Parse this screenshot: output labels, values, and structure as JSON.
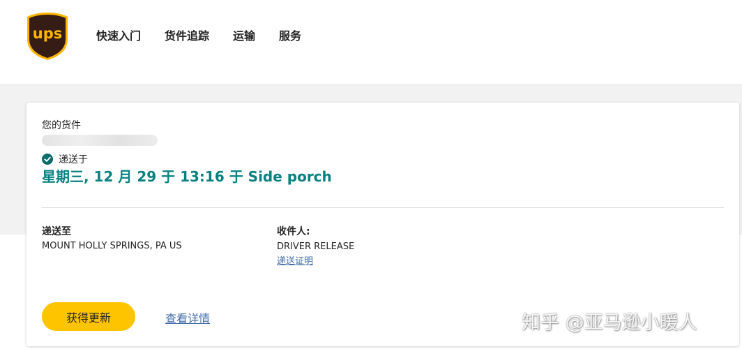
{
  "header": {
    "logo_text": "ups",
    "nav": [
      {
        "label": "快速入门"
      },
      {
        "label": "货件追踪"
      },
      {
        "label": "运输"
      },
      {
        "label": "服务"
      }
    ]
  },
  "shipment": {
    "title": "您的货件",
    "status_label": "递送于",
    "delivery_date": "星期三, 12 月 29 于 13:16 于 Side porch",
    "delivered_to_label": "递送至",
    "delivered_to_value": "MOUNT HOLLY SPRINGS, PA US",
    "received_by_label": "收件人:",
    "received_by_value": "DRIVER RELEASE",
    "proof_link": "递送证明",
    "get_updates_button": "获得更新",
    "view_details_link": "查看详情"
  },
  "watermark": "知乎 @亚马逊小暖人",
  "colors": {
    "brand_brown": "#351c15",
    "brand_gold": "#ffb500",
    "accent_teal": "#0a8080",
    "button_yellow": "#ffc400",
    "link_blue": "#426da9"
  }
}
